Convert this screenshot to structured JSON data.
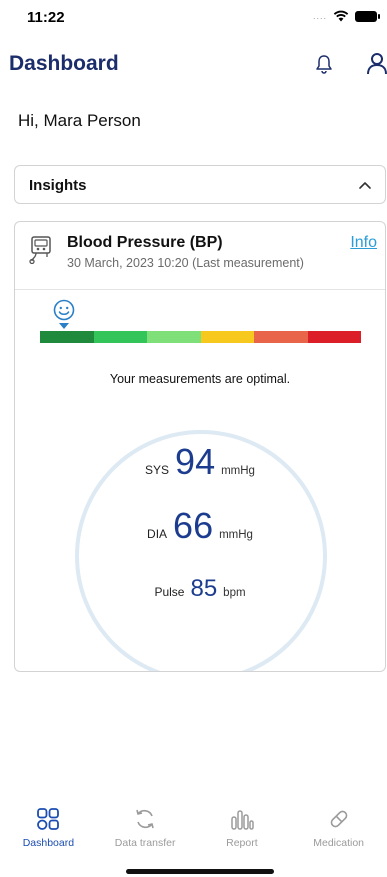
{
  "status_bar": {
    "time": "11:22",
    "signal": "....",
    "icons": [
      "wifi-icon",
      "battery-icon"
    ]
  },
  "header": {
    "title": "Dashboard",
    "icons": [
      "bell-icon",
      "user-icon"
    ]
  },
  "greeting": "Hi, Mara Person",
  "insights": {
    "label": "Insights",
    "icon": "chevron-up-icon"
  },
  "bp_card": {
    "title": "Blood Pressure (BP)",
    "subtitle": "30 March, 2023 10:20 (Last measurement)",
    "info_label": "Info",
    "icon": "bp-monitor-icon",
    "scale": {
      "indicator_icon": "smiley-icon",
      "selected_index": 0,
      "colors": [
        "#1f8a3b",
        "#33c45a",
        "#7fe07a",
        "#f7c81e",
        "#e8654a",
        "#dc1e28"
      ]
    },
    "message": "Your measurements are optimal.",
    "sys": {
      "label": "SYS",
      "value": "94",
      "unit": "mmHg"
    },
    "dia": {
      "label": "DIA",
      "value": "66",
      "unit": "mmHg"
    },
    "pulse": {
      "label": "Pulse",
      "value": "85",
      "unit": "bpm"
    }
  },
  "tabs": [
    {
      "label": "Dashboard",
      "icon": "dashboard-icon",
      "active": true
    },
    {
      "label": "Data transfer",
      "icon": "sync-icon",
      "active": false
    },
    {
      "label": "Report",
      "icon": "report-icon",
      "active": false
    },
    {
      "label": "Medication",
      "icon": "pill-icon",
      "active": false
    }
  ],
  "colors": {
    "primary": "#1c2d6b",
    "accent": "#2a9dd6",
    "value_blue": "#1c3d8f",
    "active_tab": "#1c4db0",
    "inactive_tab": "#9b9b9b"
  }
}
